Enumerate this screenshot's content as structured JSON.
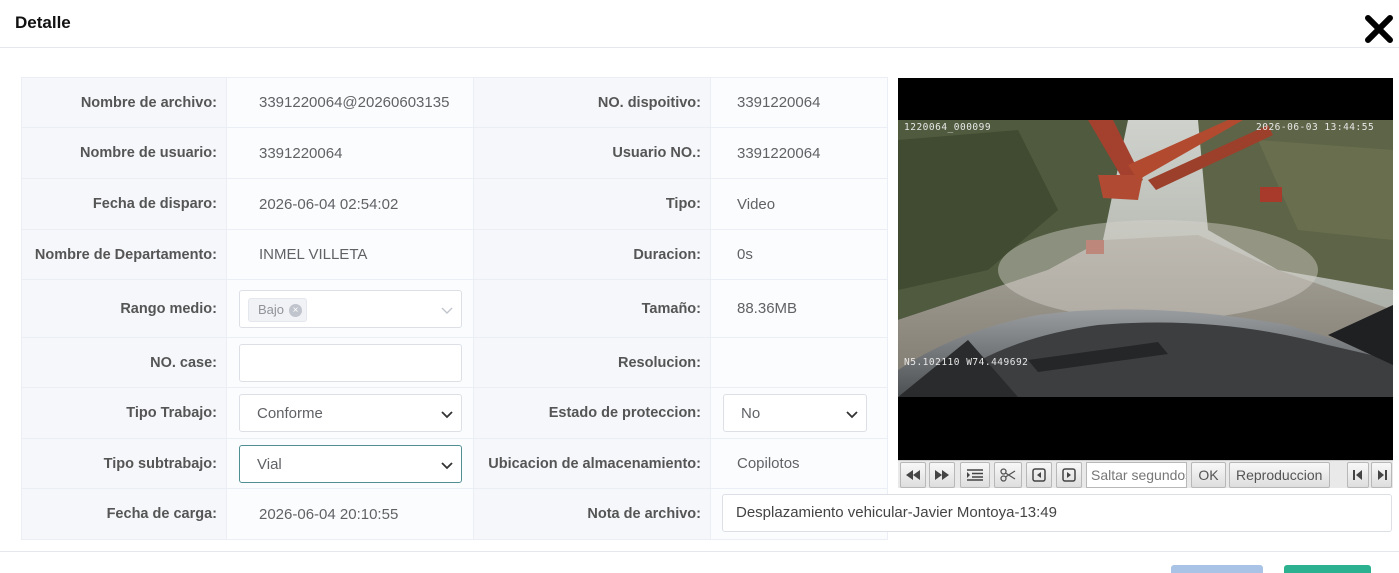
{
  "dialog": {
    "title": "Detalle"
  },
  "rows": {
    "file_name": {
      "label": "Nombre de archivo:",
      "value": "3391220064@20260603135"
    },
    "device_no": {
      "label": "NO. dispoitivo:",
      "value": "3391220064"
    },
    "user_name": {
      "label": "Nombre de usuario:",
      "value": "3391220064"
    },
    "user_no": {
      "label": "Usuario NO.:",
      "value": "3391220064"
    },
    "trigger_date": {
      "label": "Fecha de disparo:",
      "value": "2026-06-04 02:54:02"
    },
    "type": {
      "label": "Tipo:",
      "value": "Video"
    },
    "department": {
      "label": "Nombre de Departamento:",
      "value": "INMEL VILLETA"
    },
    "duration": {
      "label": "Duracion:",
      "value": "0s"
    },
    "range": {
      "label": "Rango medio:",
      "tag": "Bajo"
    },
    "size": {
      "label": "Tamaño:",
      "value": "88.36MB"
    },
    "case_no": {
      "label": "NO. case:",
      "value": ""
    },
    "resolution": {
      "label": "Resolucion:",
      "value": ""
    },
    "work_type": {
      "label": "Tipo Trabajo:",
      "value": "Conforme"
    },
    "protection": {
      "label": "Estado de proteccion:",
      "value": "No"
    },
    "sub_work": {
      "label": "Tipo subtrabajo:",
      "value": "Vial"
    },
    "storage": {
      "label": "Ubicacion de almacenamiento:",
      "value": "Copilotos"
    },
    "upload_date": {
      "label": "Fecha de carga:",
      "value": "2026-06-04 20:10:55"
    },
    "file_note": {
      "label": "Nota de archivo:",
      "value": "Desplazamiento vehicular-Javier Montoya-13:49"
    }
  },
  "video": {
    "osd_id": "1220064_000099",
    "osd_time": "2026-06-03 13:44:55",
    "osd_gps": "N5.102110 W74.449692"
  },
  "player": {
    "seek_placeholder": "Saltar segundos",
    "ok_label": "OK",
    "play_label": "Reproduccion"
  },
  "colors": {
    "accent": "#2bb18f",
    "cancel": "#a9c3e6",
    "label_bg": "#f5f7fa"
  }
}
